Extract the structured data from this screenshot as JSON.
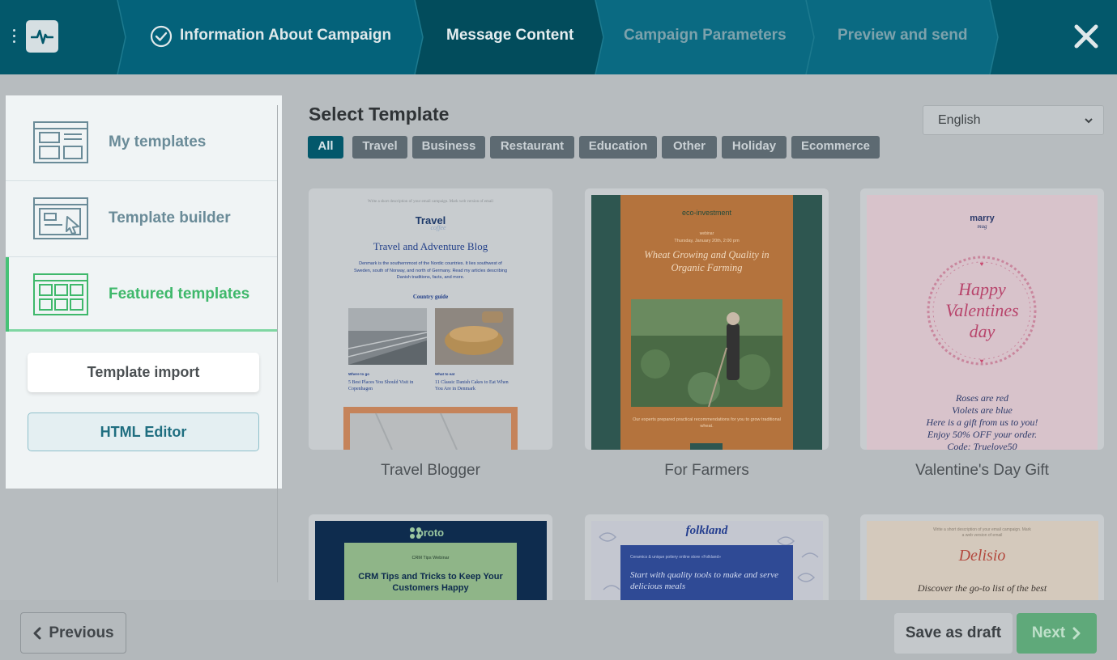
{
  "header": {
    "steps": [
      {
        "label": "Information About Campaign",
        "state": "done"
      },
      {
        "label": "Message Content",
        "state": "active"
      },
      {
        "label": "Campaign Parameters",
        "state": "future"
      },
      {
        "label": "Preview and send",
        "state": "future"
      }
    ],
    "icons": {
      "menu": "vertical-dots-icon",
      "logo": "pulse-logo-icon",
      "check": "check-circle-icon",
      "close": "close-icon"
    }
  },
  "sidebar": {
    "items": [
      {
        "label": "My templates",
        "icon": "layout-icon"
      },
      {
        "label": "Template builder",
        "icon": "builder-icon"
      },
      {
        "label": "Featured templates",
        "icon": "grid-icon",
        "active": true
      }
    ],
    "import_label": "Template import",
    "html_editor_label": "HTML Editor"
  },
  "main": {
    "title": "Select Template",
    "language": "English",
    "chips": [
      "All",
      "Travel",
      "Business",
      "Restaurant",
      "Education",
      "Other",
      "Holiday",
      "Ecommerce"
    ],
    "active_chip": "All",
    "templates": [
      {
        "name": "Travel Blogger",
        "preview": {
          "preheader": "Write a short description of your email campaign. Mark web version of email",
          "logo": "Travel",
          "logo_sub": "coffee",
          "heading": "Travel and Adventure Blog",
          "body": "Denmark is the southernmost of the Nordic countries. It lies southwest of Sweden, south of Norway, and north of Germany. Read my articles describing Danish traditions, facts, and more.",
          "section": "Country guide",
          "col1_tag": "Where to go",
          "col1_text": "5 Best Places You Should Visit in Copenhagen",
          "col2_tag": "What to eat",
          "col2_text": "11 Classic Danish Cakes to Eat When You Are in Denmark"
        }
      },
      {
        "name": "For Farmers",
        "preview": {
          "logo": "eco-investment",
          "tag": "webinar",
          "date": "Thursday, January 20th, 2:00 pm",
          "heading": "Wheat Growing and Quality in Organic Farming",
          "body": "Our experts prepared practical recommendations for you to grow traditional wheat."
        }
      },
      {
        "name": "Valentine's Day Gift",
        "preview": {
          "logo": "marry",
          "logo_sub": "mug",
          "heading1": "Happy",
          "heading2": "Valentines",
          "heading3": "day",
          "lines": [
            "Roses are red",
            "Violets are blue",
            "Here is a gift from us to you!",
            "Enjoy 50% OFF your order.",
            "Code: Truelove50"
          ]
        }
      },
      {
        "name": "",
        "preview": {
          "logo": "proto",
          "tag": "CRM Tips Webinar",
          "heading": "CRM Tips and Tricks to Keep Your Customers Happy"
        }
      },
      {
        "name": "",
        "preview": {
          "logo": "folkland",
          "tag": "Ceramics & unique pottery online store «Folkland»",
          "heading": "Start with quality tools to make and serve delicious meals"
        }
      },
      {
        "name": "",
        "preview": {
          "preheader": "Write a short description of your email campaign. Mark a web version of email",
          "logo": "Delisio",
          "heading": "Discover the go-to list of the best"
        }
      }
    ]
  },
  "footer": {
    "previous_label": "Previous",
    "draft_label": "Save as draft",
    "next_label": "Next"
  },
  "colors": {
    "header": "#03586b",
    "accent_green": "#3fb86b",
    "chip": "#5d6a72",
    "chip_active": "#03586b"
  }
}
